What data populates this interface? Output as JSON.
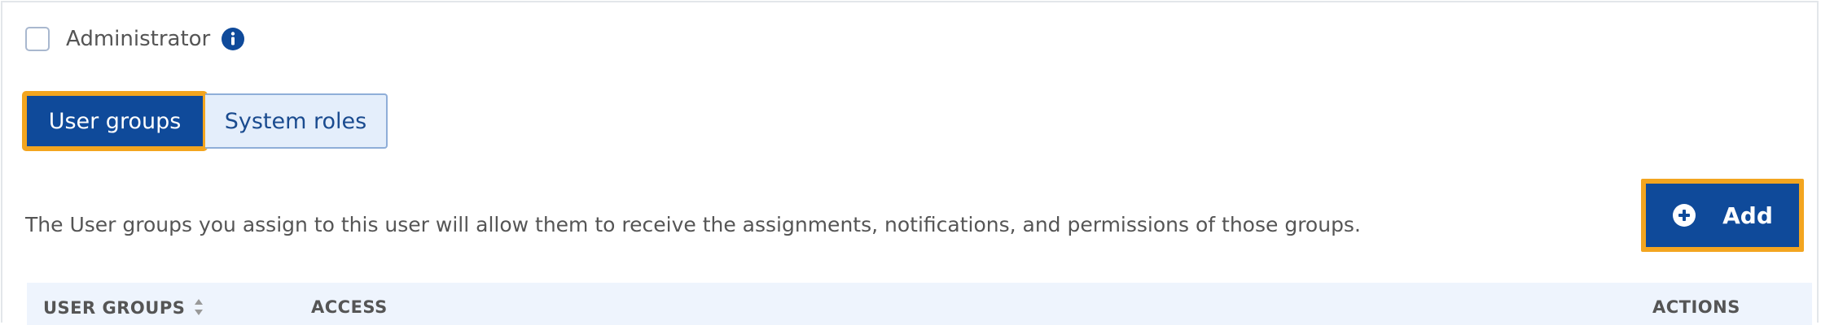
{
  "administrator": {
    "checked": false,
    "label": "Administrator",
    "info_icon": "info-icon"
  },
  "tabs": [
    {
      "label": "User groups",
      "active": true
    },
    {
      "label": "System roles",
      "active": false
    }
  ],
  "description": "The User groups you assign to this user will allow them to receive the assignments, notifications, and permissions of those groups.",
  "add_button": {
    "label": "Add",
    "icon": "plus-circle-icon"
  },
  "table": {
    "columns": [
      {
        "label": "USER GROUPS",
        "sortable": true
      },
      {
        "label": "ACCESS",
        "sortable": false
      },
      {
        "label": "ACTIONS",
        "sortable": false
      }
    ]
  },
  "colors": {
    "primary": "#0f4a9a",
    "highlight": "#f3a51f",
    "tab_inactive_bg": "#e4eefb",
    "table_header_bg": "#eef4fd"
  }
}
